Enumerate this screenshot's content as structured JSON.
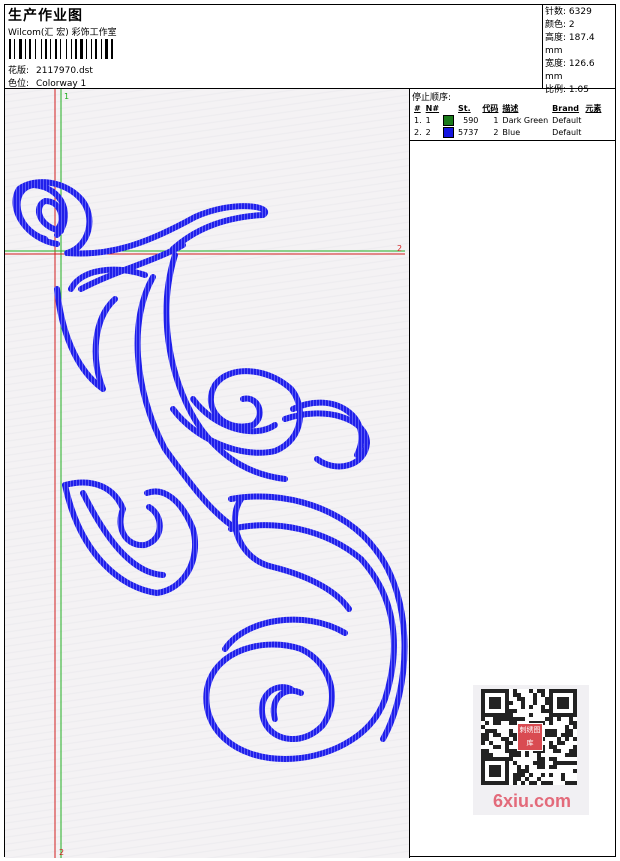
{
  "header": {
    "title": "生产作业图",
    "subtitle": "Wilcom(汇 宏) 彩饰工作室",
    "design_label": "花版:",
    "design_value": "2117970.dst",
    "colorway_label": "色位:",
    "colorway_value": "Colorway 1"
  },
  "stats": {
    "stitches": "针数: 6329",
    "colors": "颜色: 2",
    "height": "高度: 187.4 mm",
    "width": "宽度: 126.6 mm",
    "scale": "比例: 1.05"
  },
  "stop_sequence": {
    "heading": "停止顺序:",
    "columns": [
      "#",
      "N#",
      "St.",
      "代码",
      "描述",
      "Brand",
      "元素"
    ],
    "rows": [
      {
        "num": "1.",
        "needle": "1",
        "color": "#1a7a1a",
        "stitches": "590",
        "code": "1",
        "description": "Dark Green",
        "brand": "Default"
      },
      {
        "num": "2.",
        "needle": "2",
        "color": "#1515e0",
        "stitches": "5737",
        "code": "2",
        "description": "Blue",
        "brand": "Default"
      }
    ]
  },
  "design_view": {
    "marker_top": "1",
    "marker_right": "2",
    "marker_bottom": "2",
    "stitch_color": "#1f1fe8",
    "guide_red": "#d21e1e",
    "guide_green": "#1fae1f"
  },
  "watermark": {
    "stamp": "刺绣图库",
    "site": "6xiu.com"
  }
}
